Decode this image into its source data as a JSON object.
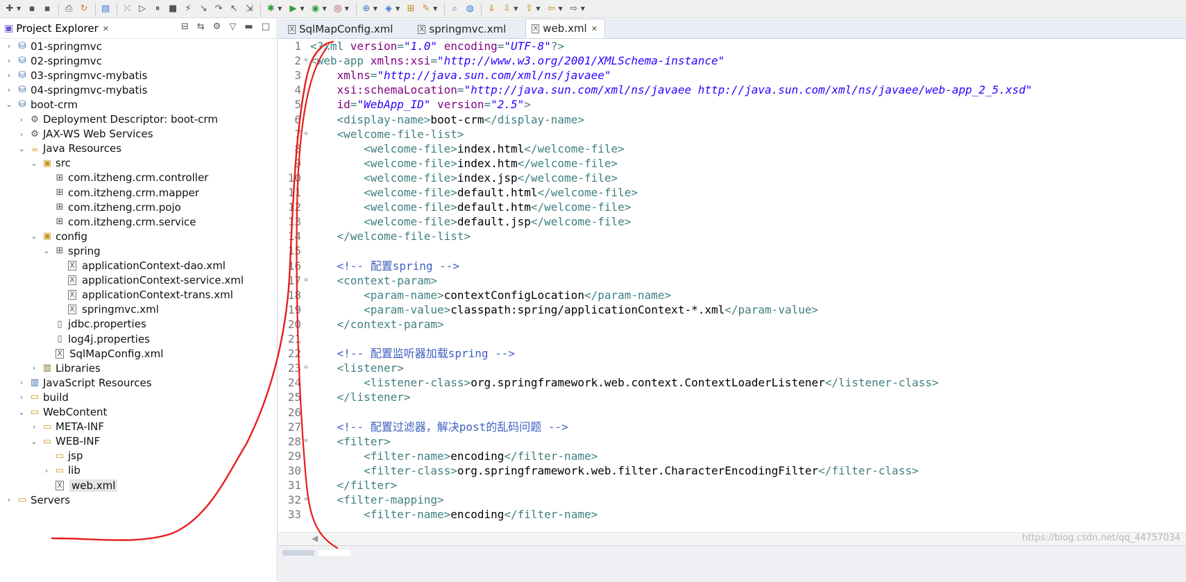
{
  "toolbar": {
    "icons": [
      "new-icon",
      "save-icon",
      "save-all-icon",
      "print-icon",
      "refresh-icon",
      "console-icon",
      "skip-icon",
      "resume-icon",
      "suspend-icon",
      "terminate-icon",
      "disconnect-icon",
      "step-into-icon",
      "step-over-icon",
      "step-return-icon",
      "drop-frame-icon",
      "debug-icon",
      "run-icon",
      "coverage-icon",
      "external-tools-icon",
      "new-server-icon",
      "new-java-project-icon",
      "open-type-icon",
      "open-task-icon",
      "search-icon",
      "globe-icon",
      "annotation-icon",
      "next-annotation-icon",
      "prev-annotation-icon",
      "back-icon",
      "forward-icon"
    ]
  },
  "explorer": {
    "title": "Project Explorer",
    "tree": [
      {
        "label": "01-springmvc",
        "depth": 0,
        "expanded": false,
        "icon": "project"
      },
      {
        "label": "02-springmvc",
        "depth": 0,
        "expanded": false,
        "icon": "project"
      },
      {
        "label": "03-springmvc-mybatis",
        "depth": 0,
        "expanded": false,
        "icon": "project"
      },
      {
        "label": "04-springmvc-mybatis",
        "depth": 0,
        "expanded": false,
        "icon": "project"
      },
      {
        "label": "boot-crm",
        "depth": 0,
        "expanded": true,
        "icon": "project"
      },
      {
        "label": "Deployment Descriptor: boot-crm",
        "depth": 1,
        "expanded": false,
        "icon": "descriptor"
      },
      {
        "label": "JAX-WS Web Services",
        "depth": 1,
        "expanded": false,
        "icon": "services"
      },
      {
        "label": "Java Resources",
        "depth": 1,
        "expanded": true,
        "icon": "resources"
      },
      {
        "label": "src",
        "depth": 2,
        "expanded": true,
        "icon": "src-folder"
      },
      {
        "label": "com.itzheng.crm.controller",
        "depth": 3,
        "expanded": null,
        "icon": "package"
      },
      {
        "label": "com.itzheng.crm.mapper",
        "depth": 3,
        "expanded": null,
        "icon": "package"
      },
      {
        "label": "com.itzheng.crm.pojo",
        "depth": 3,
        "expanded": null,
        "icon": "package"
      },
      {
        "label": "com.itzheng.crm.service",
        "depth": 3,
        "expanded": null,
        "icon": "package"
      },
      {
        "label": "config",
        "depth": 2,
        "expanded": true,
        "icon": "src-folder"
      },
      {
        "label": "spring",
        "depth": 3,
        "expanded": true,
        "icon": "package"
      },
      {
        "label": "applicationContext-dao.xml",
        "depth": 4,
        "expanded": null,
        "icon": "xml-file"
      },
      {
        "label": "applicationContext-service.xml",
        "depth": 4,
        "expanded": null,
        "icon": "xml-file"
      },
      {
        "label": "applicationContext-trans.xml",
        "depth": 4,
        "expanded": null,
        "icon": "xml-file"
      },
      {
        "label": "springmvc.xml",
        "depth": 4,
        "expanded": null,
        "icon": "xml-file"
      },
      {
        "label": "jdbc.properties",
        "depth": 3,
        "expanded": null,
        "icon": "file"
      },
      {
        "label": "log4j.properties",
        "depth": 3,
        "expanded": null,
        "icon": "file"
      },
      {
        "label": "SqlMapConfig.xml",
        "depth": 3,
        "expanded": null,
        "icon": "xml-file"
      },
      {
        "label": "Libraries",
        "depth": 2,
        "expanded": false,
        "icon": "library"
      },
      {
        "label": "JavaScript Resources",
        "depth": 1,
        "expanded": false,
        "icon": "js-resources"
      },
      {
        "label": "build",
        "depth": 1,
        "expanded": false,
        "icon": "folder"
      },
      {
        "label": "WebContent",
        "depth": 1,
        "expanded": true,
        "icon": "folder"
      },
      {
        "label": "META-INF",
        "depth": 2,
        "expanded": false,
        "icon": "folder"
      },
      {
        "label": "WEB-INF",
        "depth": 2,
        "expanded": true,
        "icon": "folder"
      },
      {
        "label": "jsp",
        "depth": 3,
        "expanded": null,
        "icon": "folder"
      },
      {
        "label": "lib",
        "depth": 3,
        "expanded": false,
        "icon": "folder"
      },
      {
        "label": "web.xml",
        "depth": 3,
        "expanded": null,
        "icon": "xml-file",
        "selected": true
      },
      {
        "label": "Servers",
        "depth": 0,
        "expanded": false,
        "icon": "folder"
      }
    ]
  },
  "editor": {
    "tabs": [
      {
        "label": "SqlMapConfig.xml",
        "active": false
      },
      {
        "label": "springmvc.xml",
        "active": false
      },
      {
        "label": "web.xml",
        "active": true
      }
    ],
    "lines": [
      {
        "n": "1",
        "fold": "",
        "seg": [
          [
            "tag",
            "<?xml "
          ],
          [
            "attr",
            "version"
          ],
          [
            "tag",
            "="
          ],
          [
            "val",
            "\"1.0\""
          ],
          [
            "tag",
            " "
          ],
          [
            "attr",
            "encoding"
          ],
          [
            "tag",
            "="
          ],
          [
            "val",
            "\"UTF-8\""
          ],
          [
            "tag",
            "?>"
          ]
        ]
      },
      {
        "n": "2",
        "fold": "⊖",
        "seg": [
          [
            "tag",
            "<web-app "
          ],
          [
            "attr",
            "xmlns:xsi"
          ],
          [
            "tag",
            "="
          ],
          [
            "val",
            "\"http://www.w3.org/2001/XMLSchema-instance\""
          ]
        ]
      },
      {
        "n": "3",
        "fold": "",
        "seg": [
          [
            "txt",
            "    "
          ],
          [
            "attr",
            "xmlns"
          ],
          [
            "tag",
            "="
          ],
          [
            "val",
            "\"http://java.sun.com/xml/ns/javaee\""
          ]
        ]
      },
      {
        "n": "4",
        "fold": "",
        "seg": [
          [
            "txt",
            "    "
          ],
          [
            "attr",
            "xsi:schemaLocation"
          ],
          [
            "tag",
            "="
          ],
          [
            "val",
            "\"http://java.sun.com/xml/ns/javaee http://java.sun.com/xml/ns/javaee/web-app_2_5.xsd\""
          ]
        ]
      },
      {
        "n": "5",
        "fold": "",
        "seg": [
          [
            "txt",
            "    "
          ],
          [
            "attr",
            "id"
          ],
          [
            "tag",
            "="
          ],
          [
            "val",
            "\"WebApp_ID\""
          ],
          [
            "tag",
            " "
          ],
          [
            "attr",
            "version"
          ],
          [
            "tag",
            "="
          ],
          [
            "val",
            "\"2.5\""
          ],
          [
            "tag",
            ">"
          ]
        ]
      },
      {
        "n": "6",
        "fold": "",
        "seg": [
          [
            "txt",
            "    "
          ],
          [
            "tag",
            "<display-name>"
          ],
          [
            "txt",
            "boot-crm"
          ],
          [
            "tag",
            "</display-name>"
          ]
        ]
      },
      {
        "n": "7",
        "fold": "⊖",
        "seg": [
          [
            "txt",
            "    "
          ],
          [
            "tag",
            "<welcome-file-list>"
          ]
        ]
      },
      {
        "n": "8",
        "fold": "",
        "seg": [
          [
            "txt",
            "        "
          ],
          [
            "tag",
            "<welcome-file>"
          ],
          [
            "txt",
            "index.html"
          ],
          [
            "tag",
            "</welcome-file>"
          ]
        ]
      },
      {
        "n": "9",
        "fold": "",
        "seg": [
          [
            "txt",
            "        "
          ],
          [
            "tag",
            "<welcome-file>"
          ],
          [
            "txt",
            "index.htm"
          ],
          [
            "tag",
            "</welcome-file>"
          ]
        ]
      },
      {
        "n": "10",
        "fold": "",
        "seg": [
          [
            "txt",
            "        "
          ],
          [
            "tag",
            "<welcome-file>"
          ],
          [
            "txt",
            "index.jsp"
          ],
          [
            "tag",
            "</welcome-file>"
          ]
        ]
      },
      {
        "n": "11",
        "fold": "",
        "seg": [
          [
            "txt",
            "        "
          ],
          [
            "tag",
            "<welcome-file>"
          ],
          [
            "txt",
            "default.html"
          ],
          [
            "tag",
            "</welcome-file>"
          ]
        ]
      },
      {
        "n": "12",
        "fold": "",
        "seg": [
          [
            "txt",
            "        "
          ],
          [
            "tag",
            "<welcome-file>"
          ],
          [
            "txt",
            "default.htm"
          ],
          [
            "tag",
            "</welcome-file>"
          ]
        ]
      },
      {
        "n": "13",
        "fold": "",
        "seg": [
          [
            "txt",
            "        "
          ],
          [
            "tag",
            "<welcome-file>"
          ],
          [
            "txt",
            "default.jsp"
          ],
          [
            "tag",
            "</welcome-file>"
          ]
        ]
      },
      {
        "n": "14",
        "fold": "",
        "seg": [
          [
            "txt",
            "    "
          ],
          [
            "tag",
            "</welcome-file-list>"
          ]
        ]
      },
      {
        "n": "15",
        "fold": "",
        "seg": []
      },
      {
        "n": "16",
        "fold": "",
        "seg": [
          [
            "txt",
            "    "
          ],
          [
            "com",
            "<!-- 配置spring -->"
          ]
        ]
      },
      {
        "n": "17",
        "fold": "⊖",
        "seg": [
          [
            "txt",
            "    "
          ],
          [
            "tag",
            "<context-param>"
          ]
        ]
      },
      {
        "n": "18",
        "fold": "",
        "seg": [
          [
            "txt",
            "        "
          ],
          [
            "tag",
            "<param-name>"
          ],
          [
            "txt",
            "contextConfigLocation"
          ],
          [
            "tag",
            "</param-name>"
          ]
        ]
      },
      {
        "n": "19",
        "fold": "",
        "seg": [
          [
            "txt",
            "        "
          ],
          [
            "tag",
            "<param-value>"
          ],
          [
            "txt",
            "classpath:spring/applicationContext-*.xml"
          ],
          [
            "tag",
            "</param-value>"
          ]
        ]
      },
      {
        "n": "20",
        "fold": "",
        "seg": [
          [
            "txt",
            "    "
          ],
          [
            "tag",
            "</context-param>"
          ]
        ]
      },
      {
        "n": "21",
        "fold": "",
        "seg": []
      },
      {
        "n": "22",
        "fold": "",
        "seg": [
          [
            "txt",
            "    "
          ],
          [
            "com",
            "<!-- 配置监听器加载spring -->"
          ]
        ]
      },
      {
        "n": "23",
        "fold": "⊖",
        "seg": [
          [
            "txt",
            "    "
          ],
          [
            "tag",
            "<listener>"
          ]
        ]
      },
      {
        "n": "24",
        "fold": "",
        "seg": [
          [
            "txt",
            "        "
          ],
          [
            "tag",
            "<listener-class>"
          ],
          [
            "txt",
            "org.springframework.web.context.ContextLoaderListener"
          ],
          [
            "tag",
            "</listener-class>"
          ]
        ]
      },
      {
        "n": "25",
        "fold": "",
        "seg": [
          [
            "txt",
            "    "
          ],
          [
            "tag",
            "</listener>"
          ]
        ]
      },
      {
        "n": "26",
        "fold": "",
        "seg": []
      },
      {
        "n": "27",
        "fold": "",
        "seg": [
          [
            "txt",
            "    "
          ],
          [
            "com",
            "<!-- 配置过滤器，解决post的乱码问题 -->"
          ]
        ]
      },
      {
        "n": "28",
        "fold": "⊖",
        "seg": [
          [
            "txt",
            "    "
          ],
          [
            "tag",
            "<filter>"
          ]
        ]
      },
      {
        "n": "29",
        "fold": "",
        "seg": [
          [
            "txt",
            "        "
          ],
          [
            "tag",
            "<filter-name>"
          ],
          [
            "txt",
            "encoding"
          ],
          [
            "tag",
            "</filter-name>"
          ]
        ]
      },
      {
        "n": "30",
        "fold": "",
        "seg": [
          [
            "txt",
            "        "
          ],
          [
            "tag",
            "<filter-class>"
          ],
          [
            "txt",
            "org.springframework.web.filter.CharacterEncodingFilter"
          ],
          [
            "tag",
            "</filter-class>"
          ]
        ]
      },
      {
        "n": "31",
        "fold": "",
        "seg": [
          [
            "txt",
            "    "
          ],
          [
            "tag",
            "</filter>"
          ]
        ]
      },
      {
        "n": "32",
        "fold": "⊖",
        "seg": [
          [
            "txt",
            "    "
          ],
          [
            "tag",
            "<filter-mapping>"
          ]
        ]
      },
      {
        "n": "33",
        "fold": "",
        "seg": [
          [
            "txt",
            "        "
          ],
          [
            "tag",
            "<filter-name>"
          ],
          [
            "txt",
            "encoding"
          ],
          [
            "tag",
            "</filter-name>"
          ]
        ]
      }
    ]
  },
  "watermark": "https://blog.csdn.net/qq_44757034"
}
